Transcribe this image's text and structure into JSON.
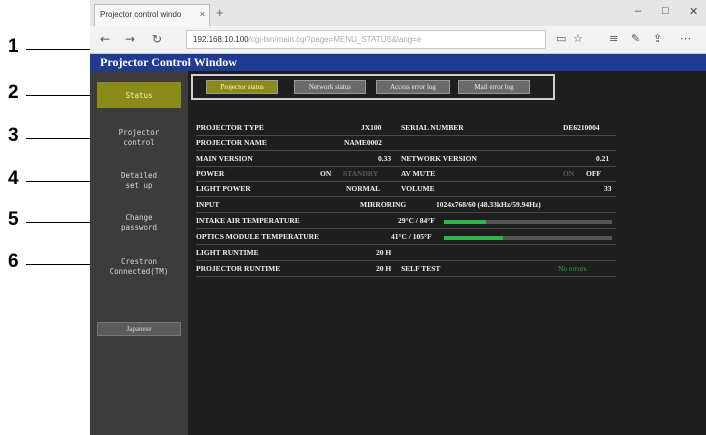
{
  "callouts": [
    "1",
    "2",
    "3",
    "4",
    "5",
    "6"
  ],
  "browser": {
    "tab_title": "Projector control windo",
    "tab_close": "×",
    "new_tab": "+",
    "minimize": "–",
    "maximize": "□",
    "close": "✕",
    "back": "←",
    "forward": "→",
    "refresh": "↻",
    "url_host": "192.168.10.100",
    "url_rest": "/cgi-bin/main.cgi?page=MENU_STATUS&lang=e",
    "icons": [
      "reading-view-icon",
      "favorite-star-icon",
      "hub-icon",
      "note-icon",
      "share-icon",
      "more-icon"
    ]
  },
  "app": {
    "title": "Projector Control Window"
  },
  "sidebar": {
    "items": [
      {
        "label": "Status"
      },
      {
        "label": "Projector\ncontrol"
      },
      {
        "label": "Detailed\nset up"
      },
      {
        "label": "Change\npassword"
      },
      {
        "label": "Crestron\nConnected(TM)"
      }
    ],
    "language_button": "Japanese"
  },
  "tabs": [
    {
      "label": "Projector status"
    },
    {
      "label": "Network status"
    },
    {
      "label": "Access error log"
    },
    {
      "label": "Mail error log"
    }
  ],
  "status": {
    "projector_type_label": "PROJECTOR TYPE",
    "projector_type_value": "JX100",
    "serial_label": "SERIAL NUMBER",
    "serial_value": "DE6210004",
    "name_label": "PROJECTOR NAME",
    "name_value": "NAME0002",
    "main_version_label": "MAIN VERSION",
    "main_version_value": "0.33",
    "network_version_label": "NETWORK VERSION",
    "network_version_value": "0.21",
    "power_label": "POWER",
    "power_on": "ON",
    "power_standby": "STANDBY",
    "av_mute_label": "AV MUTE",
    "av_mute_on": "ON",
    "av_mute_off": "OFF",
    "light_power_label": "LIGHT POWER",
    "light_power_value": "NORMAL",
    "volume_label": "VOLUME",
    "volume_value": "33",
    "input_label": "INPUT",
    "input_value": "MIRRORING",
    "input_signal": "1024x768/60 (48.33kHz/59.94Hz)",
    "intake_label": "INTAKE AIR TEMPERATURE",
    "intake_value": "29°C / 84°F",
    "intake_level": 0.25,
    "optics_label": "OPTICS MODULE TEMPERATURE",
    "optics_value": "41°C / 105°F",
    "optics_level": 0.35,
    "light_runtime_label": "LIGHT RUNTIME",
    "light_runtime_value": "20 H",
    "projector_runtime_label": "PROJECTOR RUNTIME",
    "projector_runtime_value": "20 H",
    "self_test_label": "SELF TEST",
    "self_test_value": "No errors"
  },
  "colors": {
    "accent": "#8b8b19",
    "header": "#1f3a93",
    "bar_fill": "#2fb54a"
  }
}
